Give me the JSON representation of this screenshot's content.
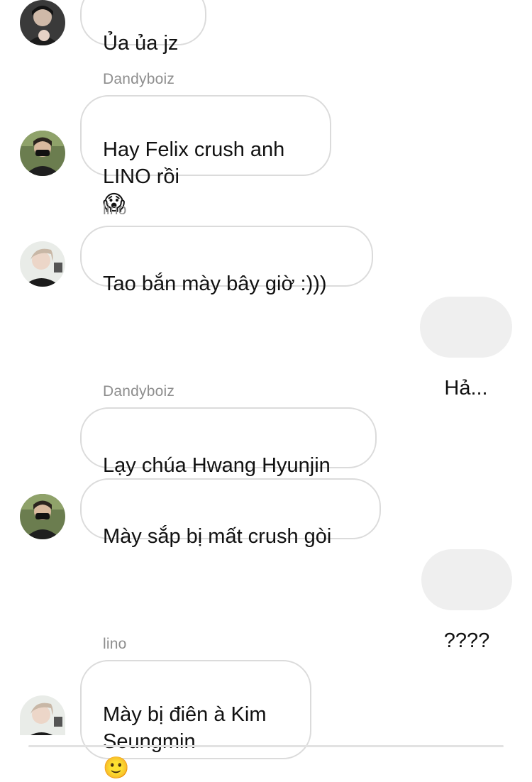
{
  "colors": {
    "incoming_bubble_border": "#dbdbdb",
    "outgoing_bubble_bg": "#efefef",
    "sender_name": "#8e8e8e",
    "text": "#111111"
  },
  "messages": {
    "m1": {
      "text": "Ủa ủa jz"
    },
    "m2": {
      "sender": "Dandyboiz",
      "text": "Hay Felix crush anh\nLINO rồi",
      "emoji": "😱"
    },
    "m3": {
      "sender": "lino",
      "text": "Tao bắn mày bây giờ :)))"
    },
    "m4": {
      "text": "Hả..."
    },
    "m5": {
      "sender": "Dandyboiz",
      "text": "Lạy chúa Hwang Hyunjin"
    },
    "m6": {
      "text": "Mày sắp bị mất crush gòi"
    },
    "m7": {
      "text": "????"
    },
    "m8": {
      "sender": "lino",
      "text": "Mày bị điên à Kim\nSeungmin",
      "emoji": "🙂"
    }
  },
  "avatars": {
    "a1": "profile-photo-dark",
    "a2": "profile-photo-masked",
    "a3": "profile-photo-light-hair",
    "a4": "profile-photo-masked",
    "a5": "profile-photo-light-hair"
  }
}
